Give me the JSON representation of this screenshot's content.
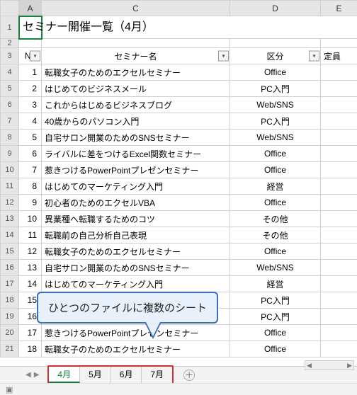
{
  "title": "セミナー開催一覧（4月）",
  "col_headers": {
    "A": "A",
    "C": "C",
    "D": "D",
    "E": "E"
  },
  "filter_headers": {
    "no": "No",
    "name": "セミナー名",
    "category": "区分",
    "capacity": "定員"
  },
  "rows": [
    {
      "n": "1",
      "name": "転職女子のためのエクセルセミナー",
      "cat": "Office"
    },
    {
      "n": "2",
      "name": "はじめてのビジネスメール",
      "cat": "PC入門"
    },
    {
      "n": "3",
      "name": "これからはじめるビジネスブログ",
      "cat": "Web/SNS"
    },
    {
      "n": "4",
      "name": "40歳からのパソコン入門",
      "cat": "PC入門"
    },
    {
      "n": "5",
      "name": "自宅サロン開業のためのSNSセミナー",
      "cat": "Web/SNS"
    },
    {
      "n": "6",
      "name": "ライバルに差をつけるExcel関数セミナー",
      "cat": "Office"
    },
    {
      "n": "7",
      "name": "惹きつけるPowerPointプレゼンセミナー",
      "cat": "Office"
    },
    {
      "n": "8",
      "name": "はじめてのマーケティング入門",
      "cat": "経営"
    },
    {
      "n": "9",
      "name": "初心者のためのエクセルVBA",
      "cat": "Office"
    },
    {
      "n": "10",
      "name": "異業種へ転職するためのコツ",
      "cat": "その他"
    },
    {
      "n": "11",
      "name": "転職前の自己分析自己表現",
      "cat": "その他"
    },
    {
      "n": "12",
      "name": "転職女子のためのエクセルセミナー",
      "cat": "Office"
    },
    {
      "n": "13",
      "name": "自宅サロン開業のためのSNSセミナー",
      "cat": "Web/SNS"
    },
    {
      "n": "14",
      "name": "はじめてのマーケティング入門",
      "cat": "経営"
    },
    {
      "n": "15",
      "name": "",
      "cat": "PC入門"
    },
    {
      "n": "16",
      "name": "",
      "cat": "PC入門"
    },
    {
      "n": "17",
      "name": "惹きつけるPowerPointプレゼンセミナー",
      "cat": "Office"
    },
    {
      "n": "18",
      "name": "転職女子のためのエクセルセミナー",
      "cat": "Office"
    }
  ],
  "row_numbers": [
    "1",
    "2",
    "3",
    "4",
    "5",
    "6",
    "7",
    "8",
    "9",
    "10",
    "11",
    "12",
    "13",
    "14",
    "15",
    "16",
    "17",
    "18",
    "19",
    "20",
    "21"
  ],
  "tabs": [
    "4月",
    "5月",
    "6月",
    "7月"
  ],
  "active_tab": "4月",
  "callout": "ひとつのファイルに複数のシート",
  "icons": {
    "filter": "▾",
    "addsheet": "＋",
    "nav_first": "|◀",
    "nav_prev": "◀",
    "scroll_left": "◀",
    "scroll_right": "▶"
  }
}
